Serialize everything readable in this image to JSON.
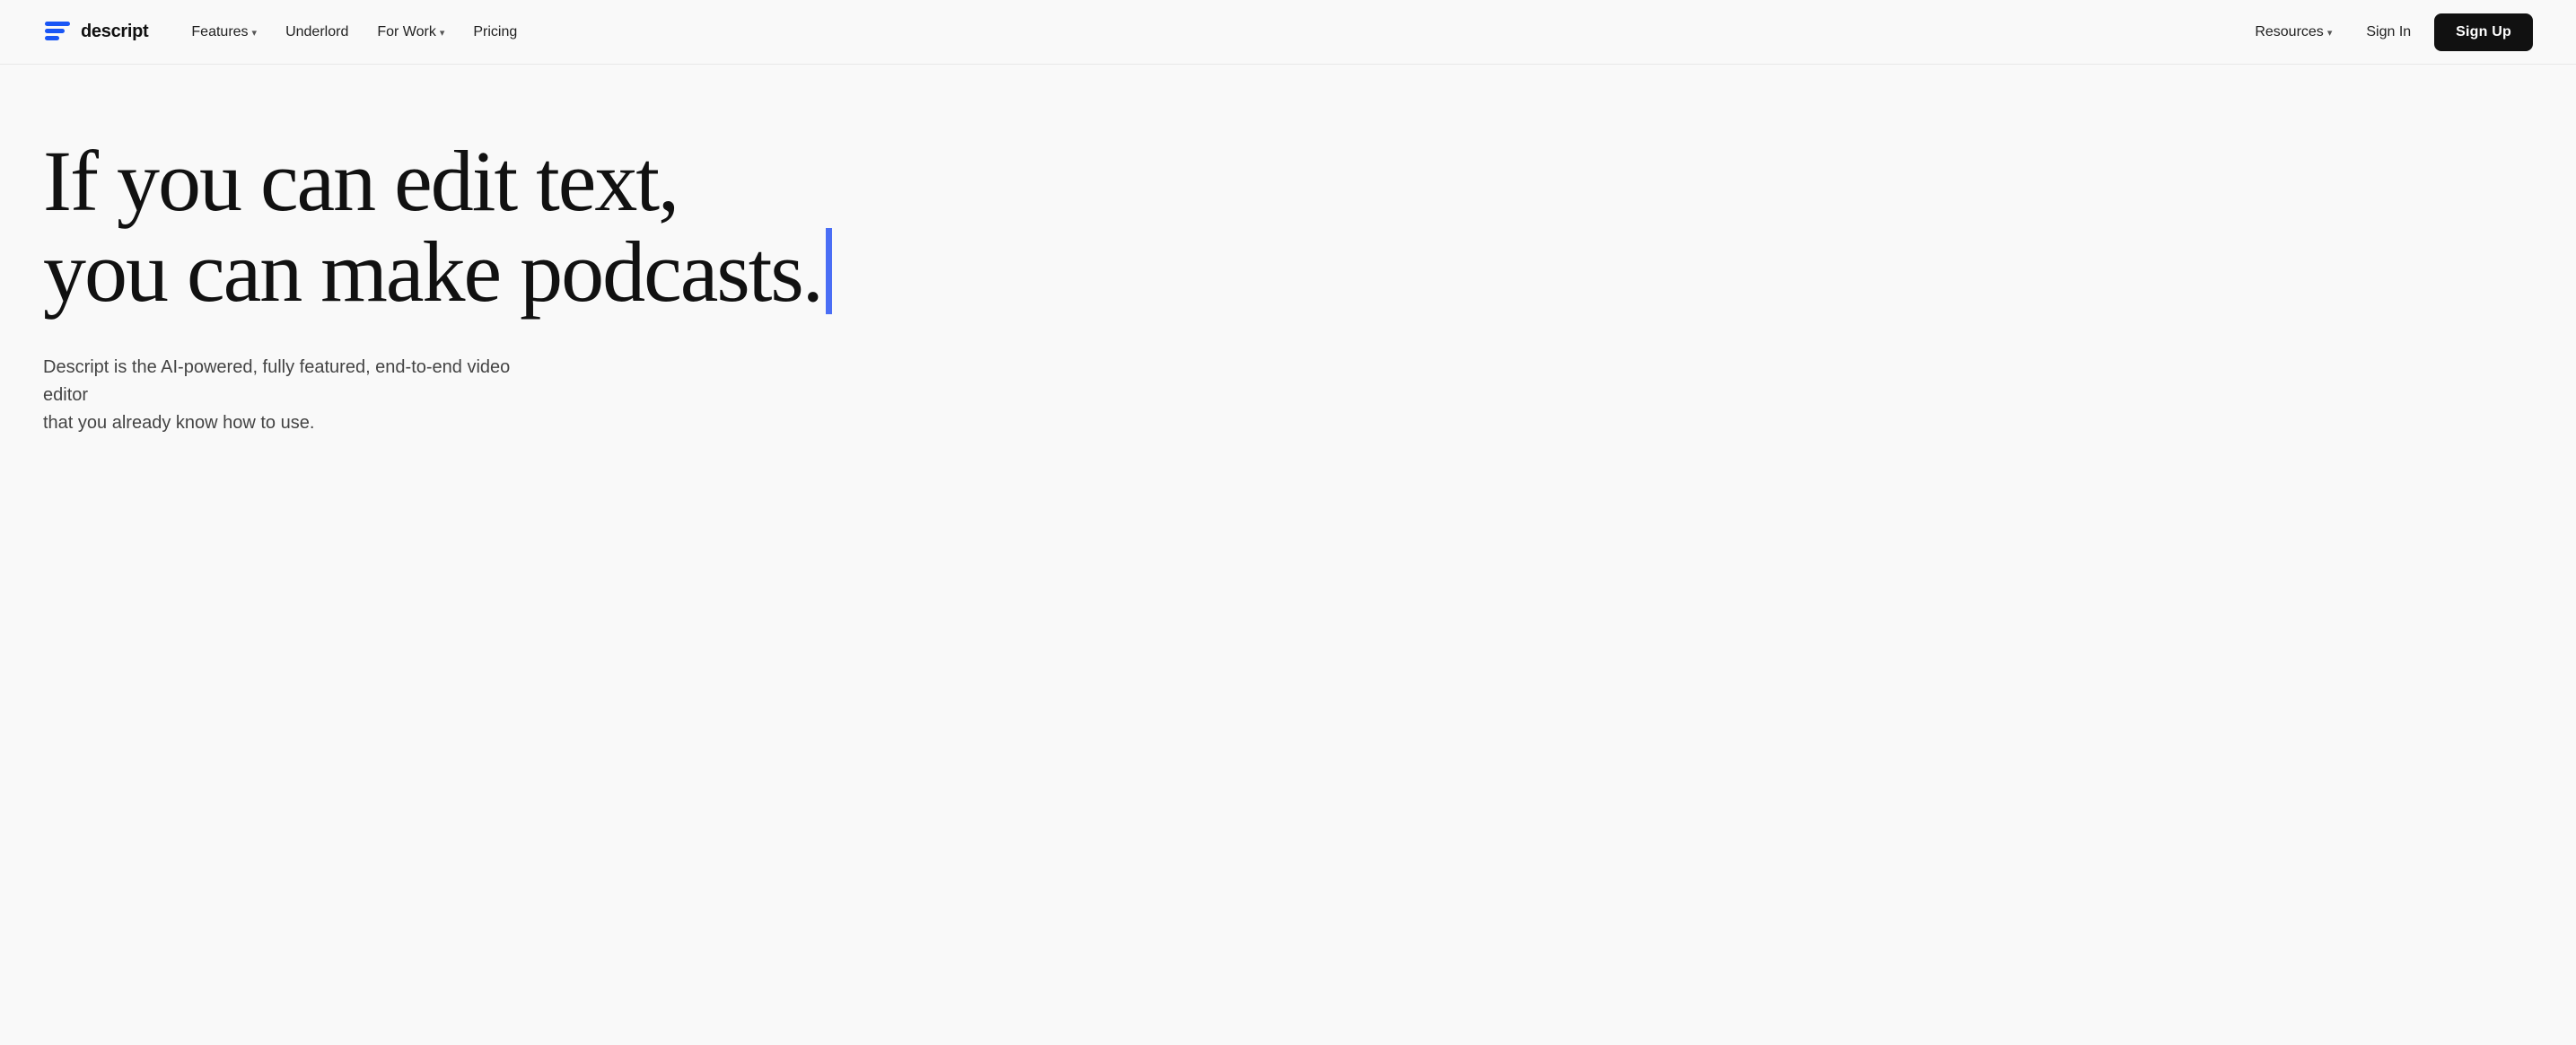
{
  "nav": {
    "logo_text": "descript",
    "links": [
      {
        "label": "Features",
        "has_chevron": true,
        "id": "features"
      },
      {
        "label": "Underlord",
        "has_chevron": false,
        "id": "underlord"
      },
      {
        "label": "For Work",
        "has_chevron": true,
        "id": "for-work"
      },
      {
        "label": "Pricing",
        "has_chevron": false,
        "id": "pricing"
      }
    ],
    "right_links": [
      {
        "label": "Resources",
        "has_chevron": true,
        "id": "resources"
      },
      {
        "label": "Sign In",
        "has_chevron": false,
        "id": "sign-in"
      },
      {
        "label": "Sign Up",
        "has_chevron": false,
        "id": "sign-up"
      }
    ]
  },
  "hero": {
    "headline_line1": "If you can edit text,",
    "headline_line2": "you can make podcasts.",
    "subtext_line1": "Descript is the AI-powered, fully featured, end-to-end video editor",
    "subtext_line2": "that you already know how to use."
  },
  "colors": {
    "cursor": "#4a6ef5",
    "nav_bg": "#f9f9f9",
    "sign_up_bg": "#111",
    "sign_up_text": "#ffffff"
  }
}
